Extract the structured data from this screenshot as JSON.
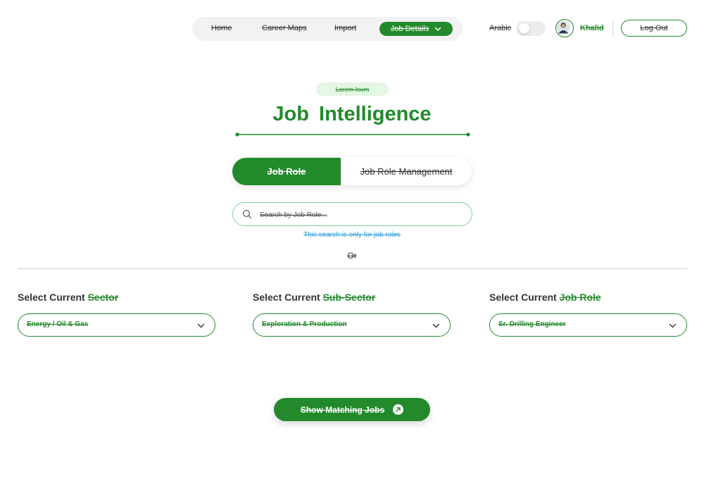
{
  "nav": {
    "items": [
      "Home",
      "Career Maps",
      "Import"
    ],
    "active": "Job Details",
    "language_label": "Arabic",
    "user_name": "Khalid",
    "logout_label": "Log Out"
  },
  "hero": {
    "badge": "Lorem Isum",
    "title": "Job  Intelligence"
  },
  "tabs": {
    "active": "Job Role",
    "inactive": "Job Role Management"
  },
  "search": {
    "placeholder": "Search by Job Role...",
    "hint": "This search is only for job roles",
    "or_text": "Or"
  },
  "selects": [
    {
      "label_prefix": "Select Current ",
      "label_accent": "Sector",
      "value": "Energy / Oil & Gas"
    },
    {
      "label_prefix": "Select Current ",
      "label_accent": "Sub-Sector",
      "value": "Exploration & Production"
    },
    {
      "label_prefix": "Select Current ",
      "label_accent": "Job Role",
      "value": "Sr. Drilling Engineer"
    }
  ],
  "cta": {
    "label": "Show Matching Jobs"
  },
  "colors": {
    "brand_green": "#238a2b",
    "badge_bg": "#e4f6e4",
    "hint_blue": "#2e9fd6",
    "search_border": "#7fd19a"
  },
  "icons": [
    "chevron-down-icon",
    "search-icon",
    "arrow-up-right-icon",
    "avatar"
  ]
}
